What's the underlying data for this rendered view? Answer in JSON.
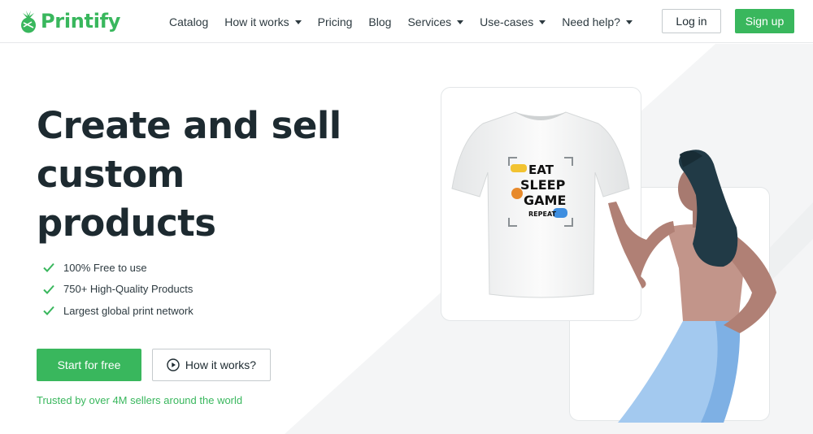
{
  "brand": {
    "name": "Printify",
    "color": "#39b75d"
  },
  "nav": {
    "items": [
      {
        "label": "Catalog",
        "dropdown": false
      },
      {
        "label": "How it works",
        "dropdown": true
      },
      {
        "label": "Pricing",
        "dropdown": false
      },
      {
        "label": "Blog",
        "dropdown": false
      },
      {
        "label": "Services",
        "dropdown": true
      },
      {
        "label": "Use-cases",
        "dropdown": true
      },
      {
        "label": "Need help?",
        "dropdown": true
      }
    ],
    "login_label": "Log in",
    "signup_label": "Sign up"
  },
  "hero": {
    "headline_lines": [
      "Create and sell",
      "custom",
      "products"
    ],
    "features": [
      "100% Free to use",
      "750+ High-Quality Products",
      "Largest global print network"
    ],
    "primary_cta": "Start for free",
    "secondary_cta": "How it works?",
    "trusted_text": "Trusted by over 4M sellers around the world"
  },
  "shirt_print": {
    "lines": [
      "EAT",
      "SLEEP",
      "GAME",
      "REPEAT"
    ]
  },
  "icons": [
    "logo-icon",
    "caret-down-icon",
    "check-icon",
    "play-circle-icon"
  ]
}
